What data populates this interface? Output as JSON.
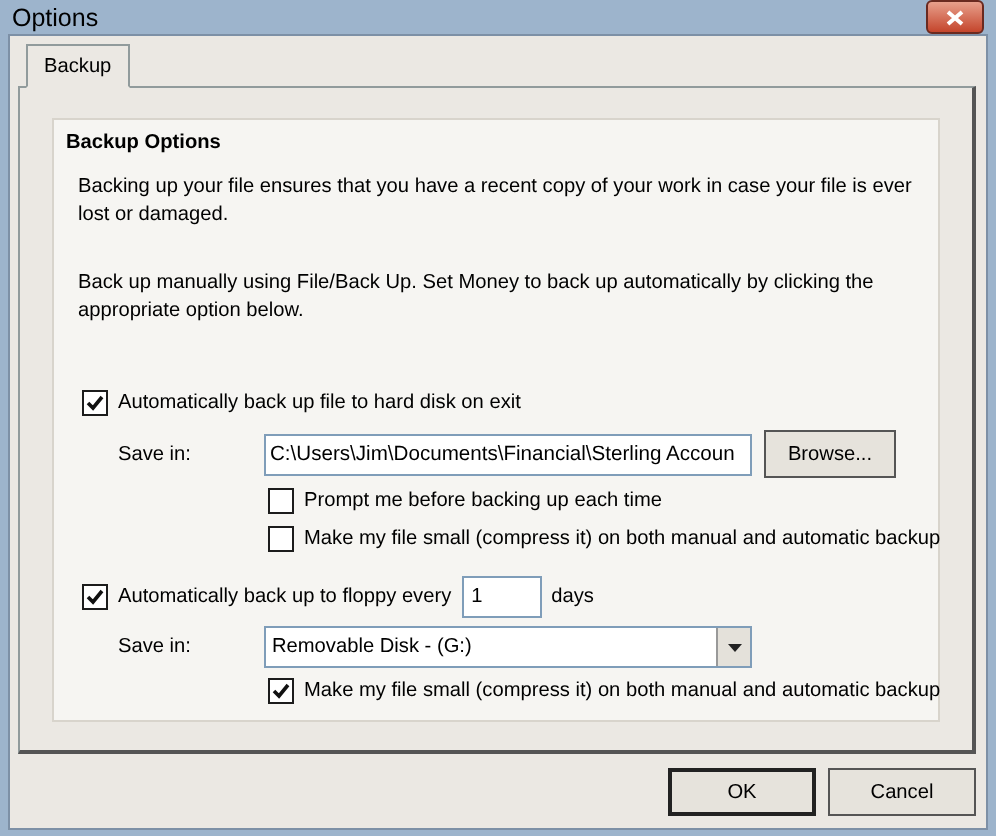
{
  "window": {
    "title": "Options"
  },
  "tabs": [
    {
      "label": "Backup",
      "selected": true
    }
  ],
  "group": {
    "title": "Backup Options",
    "paragraphs": [
      "Backing up your file ensures that you have a recent copy of your work in case your file is ever lost or damaged.",
      "Back up manually using File/Back Up. Set Money to back up automatically by clicking the appropriate option below."
    ]
  },
  "hard_disk": {
    "checkbox": {
      "label": "Automatically back up file to hard disk on exit",
      "checked": true
    },
    "save_in": {
      "label": "Save in:",
      "value": "C:\\Users\\Jim\\Documents\\Financial\\Sterling Accoun",
      "kind": "text"
    },
    "browse_button": "Browse...",
    "options": [
      {
        "label": "Prompt me before backing up each time",
        "checked": false
      },
      {
        "label": "Make my file small (compress it) on both manual and automatic backup",
        "checked": false
      }
    ]
  },
  "floppy": {
    "checkbox": {
      "label": "Automatically back up to floppy every",
      "checked": true
    },
    "days_value": "1",
    "days_label": "days",
    "save_in": {
      "label": "Save in:",
      "value": "Removable Disk -  (G:)",
      "kind": "dropdown"
    },
    "options": [
      {
        "label": "Make my file small (compress it) on both manual and automatic backup",
        "checked": true
      }
    ]
  },
  "buttons": [
    {
      "label": "OK",
      "default": true
    },
    {
      "label": "Cancel",
      "default": false
    }
  ]
}
